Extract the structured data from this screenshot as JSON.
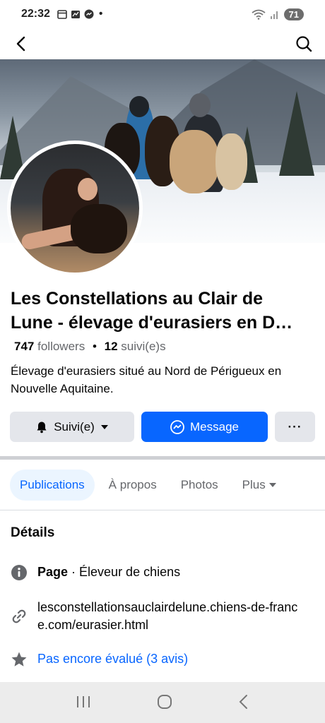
{
  "status_bar": {
    "time": "22:32",
    "battery": "71",
    "dot": "•"
  },
  "nav": {
    "back_icon": "arrow-left-icon",
    "search_icon": "search-icon"
  },
  "profile": {
    "title_line1": "Les Constellations au Clair de",
    "title_line2": "Lune - élevage d'eurasiers en D…",
    "followers_count": "747",
    "followers_label": "followers",
    "separator": "•",
    "following_count": "12",
    "following_label": "suivi(e)s",
    "bio": "Élevage d'eurasiers situé au Nord de Périgueux en Nouvelle Aquitaine."
  },
  "actions": {
    "follow_label": "Suivi(e)",
    "message_label": "Message",
    "more_label": "···"
  },
  "tabs": [
    {
      "label": "Publications",
      "active": true
    },
    {
      "label": "À propos",
      "active": false
    },
    {
      "label": "Photos",
      "active": false
    },
    {
      "label": "Plus",
      "active": false
    }
  ],
  "details": {
    "title": "Détails",
    "page_label": "Page",
    "page_category": " · Éleveur de chiens",
    "website": "lesconstellationsauclairdelune.chiens-de-france.com/eurasier.html",
    "rating": "Pas encore évalué (3 avis)"
  },
  "colors": {
    "accent": "#0866ff",
    "secondary_text": "#65676b",
    "button_gray": "#e4e6eb"
  }
}
